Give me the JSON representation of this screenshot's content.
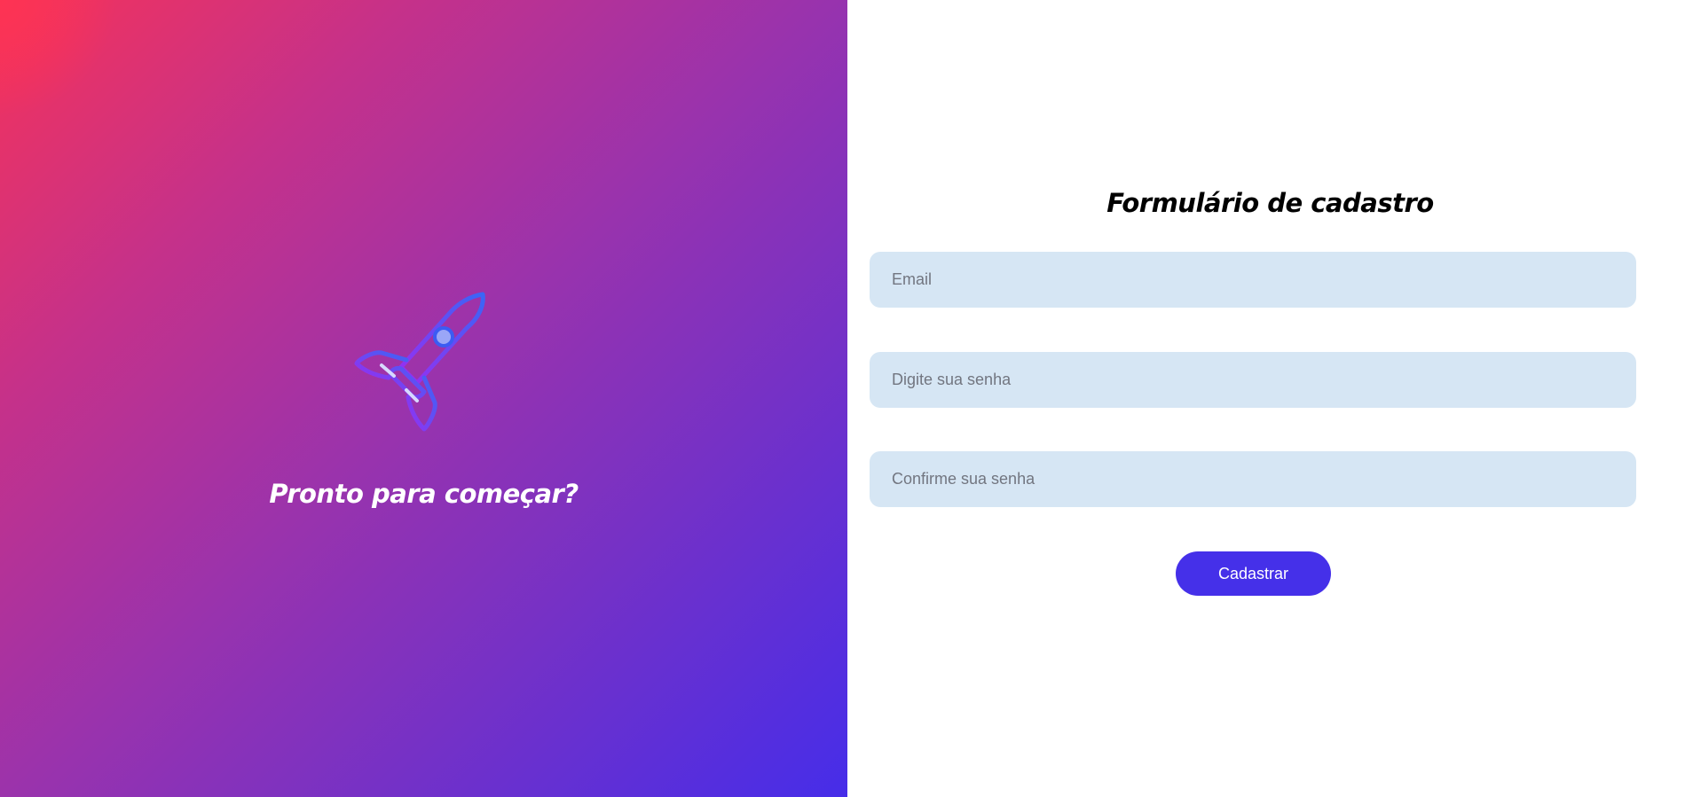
{
  "hero": {
    "icon": "rocket-icon",
    "title": "Pronto para começar?"
  },
  "form": {
    "title": "Formulário de cadastro",
    "email_placeholder": "Email",
    "password_placeholder": "Digite sua senha",
    "confirm_placeholder": "Confirme sua senha",
    "submit_label": "Cadastrar"
  },
  "colors": {
    "gradient_start": "#fe3353",
    "gradient_end": "#462de9",
    "input_bg": "#d6e6f4",
    "button_bg": "#4530e9"
  }
}
